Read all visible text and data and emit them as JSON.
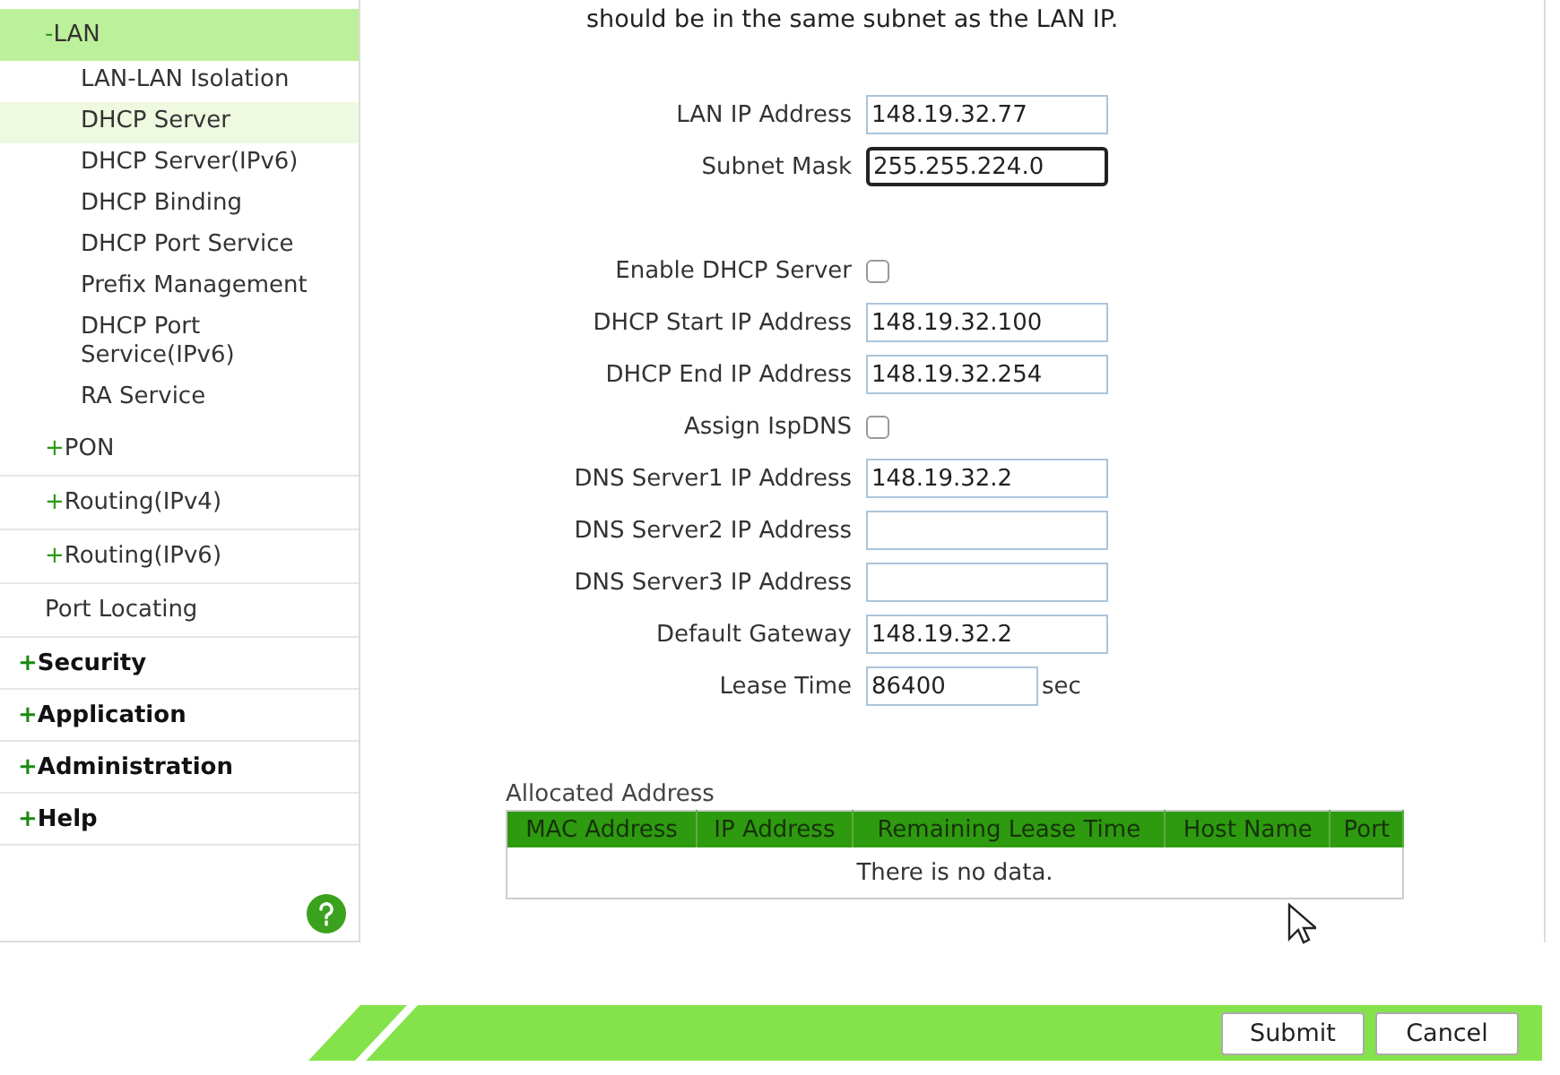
{
  "sidebar": {
    "subitems": [
      {
        "marker": "-",
        "label": "LAN",
        "expanded": true,
        "children": [
          {
            "label": "LAN-LAN Isolation",
            "selected": false
          },
          {
            "label": "DHCP Server",
            "selected": true
          },
          {
            "label": "DHCP Server(IPv6)",
            "selected": false
          },
          {
            "label": "DHCP Binding",
            "selected": false
          },
          {
            "label": "DHCP Port Service",
            "selected": false
          },
          {
            "label": "Prefix Management",
            "selected": false
          },
          {
            "label": "DHCP Port Service(IPv6)",
            "selected": false
          },
          {
            "label": "RA Service",
            "selected": false
          }
        ]
      },
      {
        "marker": "+",
        "label": "PON",
        "expanded": false
      },
      {
        "marker": "+",
        "label": "Routing(IPv4)",
        "expanded": false
      },
      {
        "marker": "+",
        "label": "Routing(IPv6)",
        "expanded": false
      },
      {
        "label": "Port Locating",
        "expanded": false
      }
    ],
    "sections": [
      {
        "marker": "+",
        "label": "Security"
      },
      {
        "marker": "+",
        "label": "Application"
      },
      {
        "marker": "+",
        "label": "Administration"
      },
      {
        "marker": "+",
        "label": "Help"
      }
    ]
  },
  "intro": "should be in the same subnet as the LAN IP.",
  "lan_fields": [
    {
      "kind": "text",
      "label": "LAN IP Address",
      "value": "148.19.32.77",
      "focused": false
    },
    {
      "kind": "text",
      "label": "Subnet Mask",
      "value": "255.255.224.0",
      "focused": true
    }
  ],
  "dhcp_fields": [
    {
      "kind": "checkbox",
      "label": "Enable DHCP Server",
      "checked": false
    },
    {
      "kind": "text",
      "label": "DHCP Start IP Address",
      "value": "148.19.32.100",
      "focused": false
    },
    {
      "kind": "text",
      "label": "DHCP End IP Address",
      "value": "148.19.32.254",
      "focused": false
    },
    {
      "kind": "checkbox",
      "label": "Assign IspDNS",
      "checked": false
    },
    {
      "kind": "text",
      "label": "DNS Server1 IP Address",
      "value": "148.19.32.2",
      "focused": false
    },
    {
      "kind": "text",
      "label": "DNS Server2 IP Address",
      "focused": false
    },
    {
      "kind": "text",
      "label": "DNS Server3 IP Address",
      "focused": false
    },
    {
      "kind": "text",
      "label": "Default Gateway",
      "value": "148.19.32.2",
      "focused": false
    },
    {
      "kind": "short",
      "label": "Lease Time",
      "value": "86400",
      "unit": "sec",
      "focused": false
    }
  ],
  "table": {
    "title": "Allocated Address",
    "columns": [
      "MAC Address",
      "IP Address",
      "Remaining Lease Time",
      "Host Name",
      "Port"
    ],
    "empty_text": "There is no data."
  },
  "buttons": [
    "Submit",
    "Cancel"
  ]
}
